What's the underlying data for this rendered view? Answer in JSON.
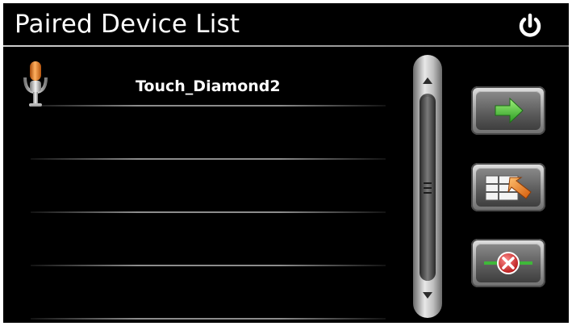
{
  "header": {
    "title": "Paired Device List",
    "power_icon": "power-icon"
  },
  "devices": [
    {
      "name": "Touch_Diamond2",
      "icon": "microphone-headset-icon"
    },
    {
      "name": "",
      "icon": ""
    },
    {
      "name": "",
      "icon": ""
    },
    {
      "name": "",
      "icon": ""
    },
    {
      "name": "",
      "icon": ""
    }
  ],
  "scrollbar": {
    "up_icon": "scroll-up-arrow-icon",
    "down_icon": "scroll-down-arrow-icon"
  },
  "actions": [
    {
      "id": "connect",
      "icon": "green-arrow-right-icon"
    },
    {
      "id": "transfer",
      "icon": "table-transfer-arrow-icon"
    },
    {
      "id": "delete",
      "icon": "red-x-disconnect-icon"
    }
  ],
  "colors": {
    "background": "#000000",
    "text": "#ffffff",
    "accent_green": "#3fb83a",
    "accent_orange": "#f07a1a",
    "accent_red": "#d92020"
  }
}
